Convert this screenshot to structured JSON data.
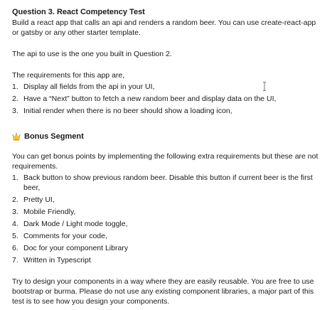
{
  "doc": {
    "title": "Question 3. React Competency Test",
    "intro": "Build a react app that calls an api and renders a random beer. You can use create-react-app or gatsby or any other starter template.",
    "api_note": "The api to use is the one you built in Question 2.",
    "requirements_intro": "The requirements for this app are,",
    "requirements": [
      "Display all fields from the api in your UI,",
      "Have a “Next” button to fetch a new random beer and display data on the UI,",
      "Initial render when there is no beer should show a loading icon,"
    ],
    "bonus_title": "Bonus Segment",
    "bonus_icon": "crown-emoji-icon",
    "bonus_intro": "You can get bonus points by implementing the following extra requirements but these are not requirements.",
    "bonus_items": [
      "Back button to show previous random beer. Disable this button if current beer is the first beer,",
      "Pretty UI,",
      "Mobile Friendly,",
      "Dark Mode / Light mode toggle,",
      "Comments for your code,",
      "Doc for your component Library",
      "Written in Typescript"
    ],
    "closing": "Try to design your components in a way where they are easily reusable. You are free to use bootstrap or burma. Please do not use any existing component libraries, a major part of this test is to see how you design your components."
  },
  "colors": {
    "text": "#1a1a1a",
    "crown": "#f4c542",
    "crown_dark": "#d9a21b"
  }
}
